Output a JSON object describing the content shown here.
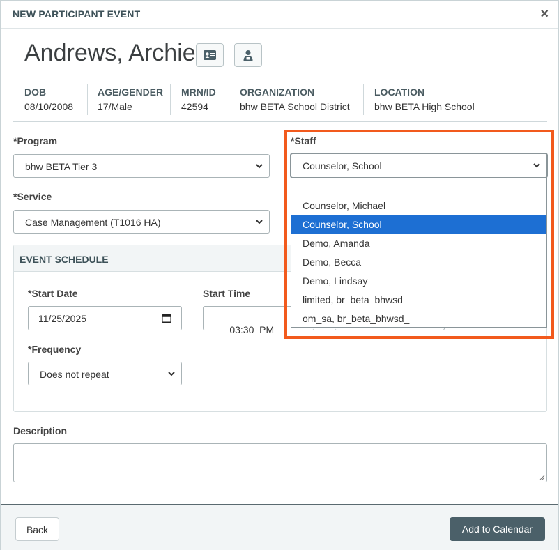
{
  "modal": {
    "title": "NEW PARTICIPANT EVENT",
    "close": "×"
  },
  "patient": {
    "name": "Andrews, Archie"
  },
  "icons": {
    "id_card": "id-card-icon",
    "staff": "staff-icon",
    "close": "close-icon",
    "calendar": "calendar-icon",
    "chevron": "chevron-down-icon"
  },
  "demographics": {
    "dob": {
      "label": "DOB",
      "value": "08/10/2008"
    },
    "age_gender": {
      "label": "AGE/GENDER",
      "value": "17/Male"
    },
    "mrn": {
      "label": "MRN/ID",
      "value": "42594"
    },
    "organization": {
      "label": "ORGANIZATION",
      "value": "bhw BETA School District"
    },
    "location": {
      "label": "LOCATION",
      "value": "bhw BETA High School"
    }
  },
  "form": {
    "program": {
      "label": "*Program",
      "value": "bhw BETA Tier 3"
    },
    "service": {
      "label": "*Service",
      "value": "Case Management (T1016 HA)"
    },
    "staff": {
      "label": "*Staff",
      "value": "Counselor, School",
      "options": [
        "",
        "Counselor, Michael",
        "Counselor, School",
        "Demo, Amanda",
        "Demo, Becca",
        "Demo, Lindsay",
        "limited, br_beta_bhwsd_",
        "om_sa, br_beta_bhwsd_"
      ],
      "selected_index": 2
    },
    "schedule": {
      "title": "EVENT SCHEDULE",
      "start_date": {
        "label": "*Start Date",
        "value": "11/25/2025"
      },
      "start_time": {
        "label": "Start Time",
        "value": "03:30  PM"
      },
      "frequency": {
        "label": "*Frequency",
        "value": "Does not repeat"
      }
    },
    "description": {
      "label": "Description",
      "value": ""
    }
  },
  "footer": {
    "back_label": "Back",
    "add_label": "Add to Calendar"
  },
  "colors": {
    "accent": "#4b6069",
    "highlight": "#f25a1d",
    "selection": "#1d6fd3"
  }
}
